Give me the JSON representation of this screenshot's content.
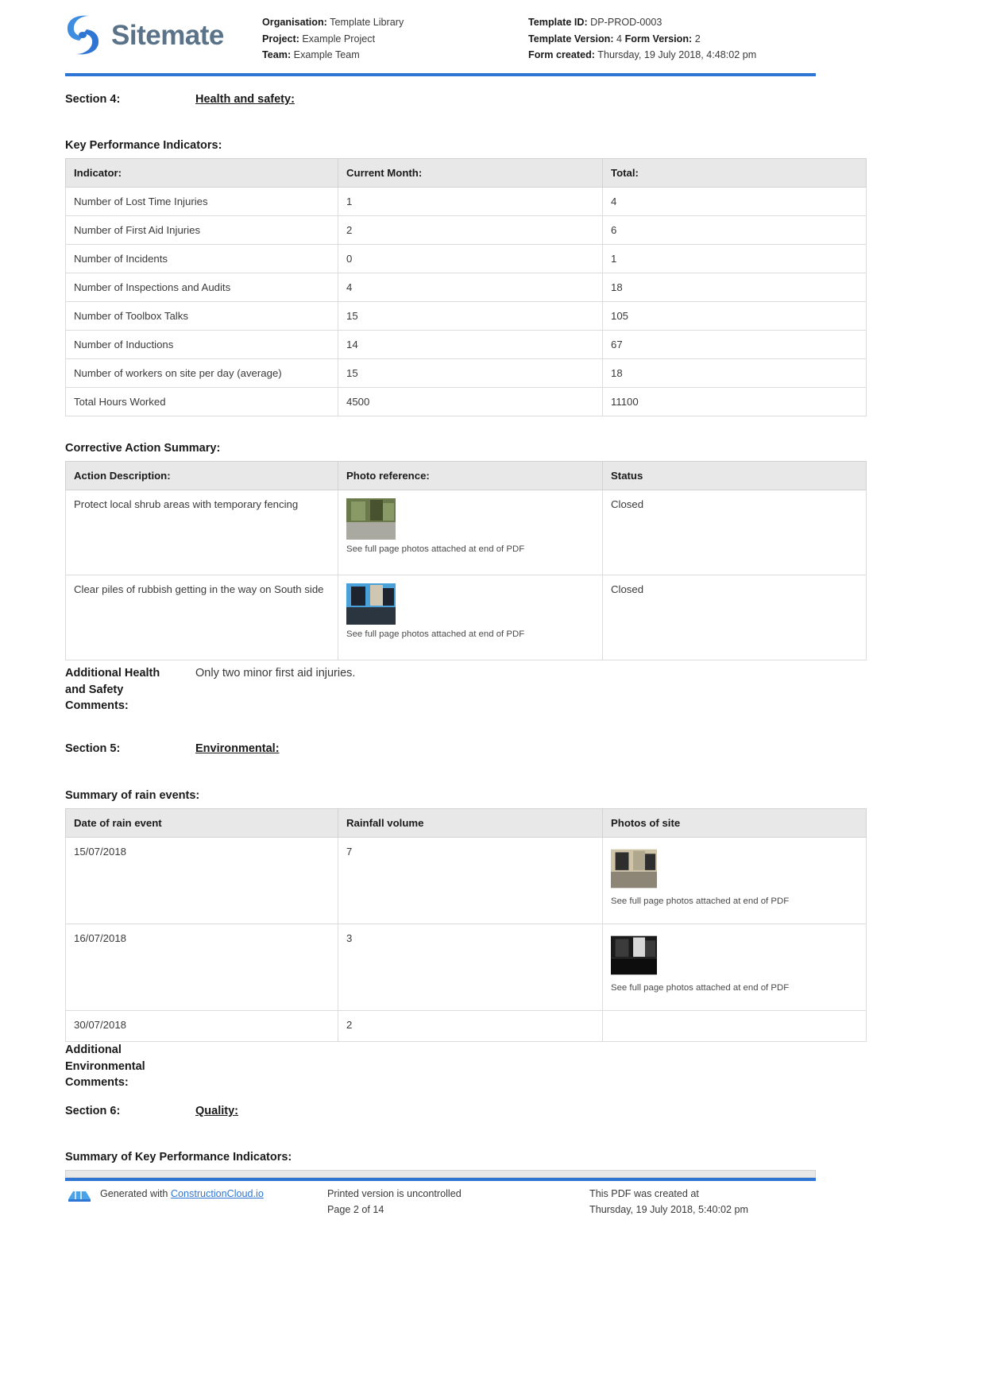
{
  "header": {
    "brand_name": "Sitemate",
    "brand_color": "#5b7388",
    "accent_color": "#2f76d4",
    "left_meta": [
      {
        "label": "Organisation:",
        "value": "Template Library"
      },
      {
        "label": "Project:",
        "value": "Example Project"
      },
      {
        "label": "Team:",
        "value": "Example Team"
      }
    ],
    "right_meta": [
      {
        "label": "Template ID:",
        "value": "DP-PROD-0003"
      },
      {
        "label": "Template Version:",
        "value": "4",
        "label2": "Form Version:",
        "value2": "2"
      },
      {
        "label": "Form created:",
        "value": "Thursday, 19 July 2018, 4:48:02 pm"
      }
    ]
  },
  "section4": {
    "label": "Section 4:",
    "title": "Health and safety:"
  },
  "kpi": {
    "heading": "Key Performance Indicators:",
    "columns": [
      "Indicator:",
      "Current Month:",
      "Total:"
    ],
    "rows": [
      {
        "indicator": "Number of Lost Time Injuries",
        "current": "1",
        "total": "4"
      },
      {
        "indicator": "Number of First Aid Injuries",
        "current": "2",
        "total": "6"
      },
      {
        "indicator": "Number of Incidents",
        "current": "0",
        "total": "1"
      },
      {
        "indicator": "Number of Inspections and Audits",
        "current": "4",
        "total": "18"
      },
      {
        "indicator": "Number of Toolbox Talks",
        "current": "15",
        "total": "105"
      },
      {
        "indicator": "Number of Inductions",
        "current": "14",
        "total": "67"
      },
      {
        "indicator": "Number of workers on site per day (average)",
        "current": "15",
        "total": "18"
      },
      {
        "indicator": "Total Hours Worked",
        "current": "4500",
        "total": "11100"
      }
    ]
  },
  "corrective": {
    "heading": "Corrective Action Summary:",
    "columns": [
      "Action Description:",
      "Photo reference:",
      "Status"
    ],
    "photo_caption": "See full page photos attached at end of PDF",
    "rows": [
      {
        "description": "Protect local shrub areas with temporary fencing",
        "status": "Closed"
      },
      {
        "description": "Clear piles of rubbish getting in the way on South side",
        "status": "Closed"
      }
    ]
  },
  "hs_comments": {
    "label": "Additional Health and Safety Comments:",
    "value": "Only two minor first aid injuries."
  },
  "section5": {
    "label": "Section 5:",
    "title": "Environmental:"
  },
  "rain": {
    "heading": "Summary of rain events:",
    "columns": [
      "Date of rain event",
      "Rainfall volume",
      "Photos of site"
    ],
    "photo_caption": "See full page photos attached at end of PDF",
    "rows": [
      {
        "date": "15/07/2018",
        "volume": "7",
        "has_photo": true
      },
      {
        "date": "16/07/2018",
        "volume": "3",
        "has_photo": true
      },
      {
        "date": "30/07/2018",
        "volume": "2",
        "has_photo": false
      }
    ]
  },
  "env_comments": {
    "label": "Additional Environmental Comments:",
    "value": ""
  },
  "section6": {
    "label": "Section 6:",
    "title": "Quality:"
  },
  "quality": {
    "heading": "Summary of Key Performance Indicators:"
  },
  "footer": {
    "generated_prefix": "Generated with",
    "generated_link": "ConstructionCloud.io",
    "uncontrolled": "Printed version is uncontrolled",
    "page": "Page 2 of 14",
    "created_label": "This PDF was created at",
    "created_value": "Thursday, 19 July 2018, 5:40:02 pm"
  }
}
